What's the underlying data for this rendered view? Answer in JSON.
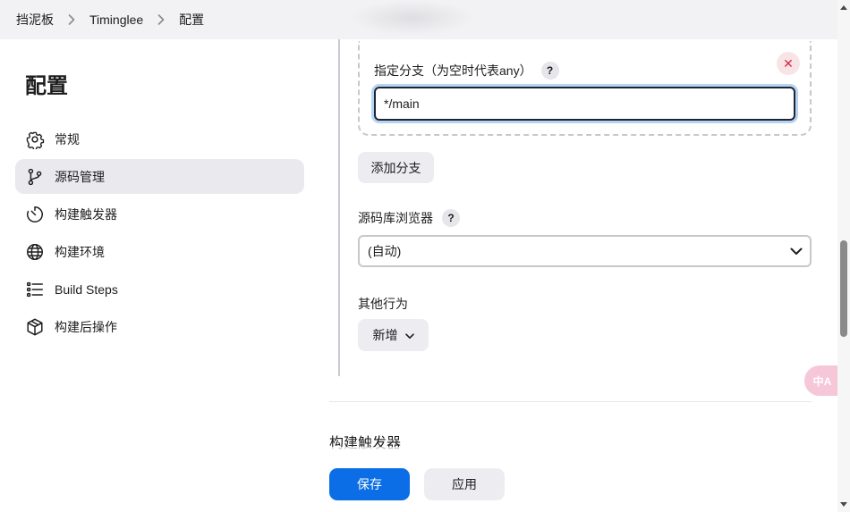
{
  "breadcrumb": {
    "items": [
      "挡泥板",
      "Timinglee",
      "配置"
    ]
  },
  "sidebar": {
    "title": "配置",
    "items": [
      {
        "label": "常规",
        "icon": "gear-icon"
      },
      {
        "label": "源码管理",
        "icon": "branch-icon",
        "active": true
      },
      {
        "label": "构建触发器",
        "icon": "timer-icon"
      },
      {
        "label": "构建环境",
        "icon": "globe-icon"
      },
      {
        "label": "Build Steps",
        "icon": "list-icon"
      },
      {
        "label": "构建后操作",
        "icon": "package-icon"
      }
    ]
  },
  "scm": {
    "branch_label": "指定分支（为空时代表any）",
    "branch_value": "*/main",
    "help": "?",
    "close": "✕",
    "add_branch": "添加分支",
    "browser_label": "源码库浏览器",
    "browser_value": "(自动)",
    "other_label": "其他行为",
    "add_new": "新增"
  },
  "next_section": "构建触发器",
  "actions": {
    "save": "保存",
    "apply": "应用"
  },
  "translate_widget": "中A",
  "colors": {
    "primary": "#0b6ee6",
    "active_nav": "#e9e9ee",
    "danger": "#d42c3f"
  }
}
